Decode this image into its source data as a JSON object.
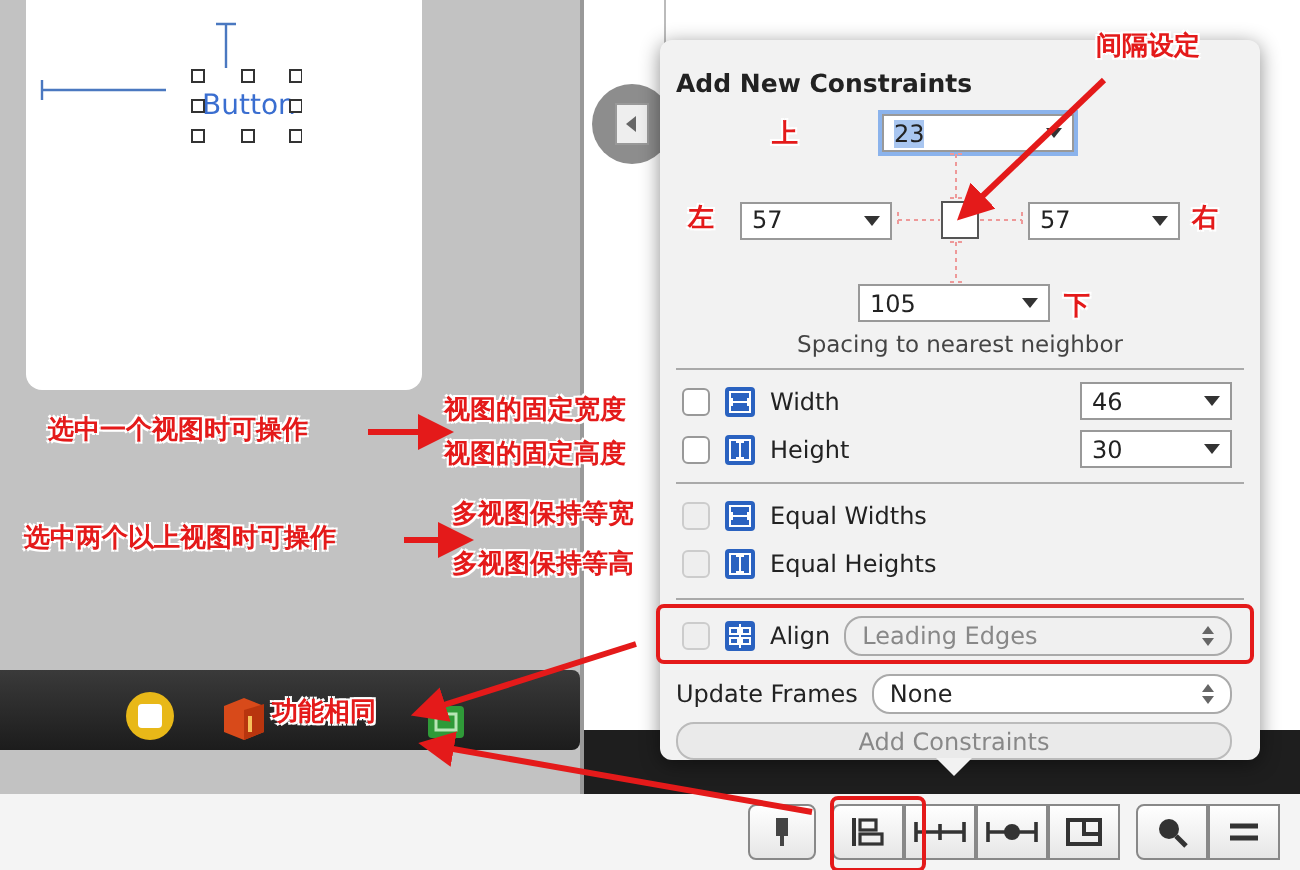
{
  "canvas": {
    "button_label": "Button"
  },
  "popover": {
    "title": "Add New Constraints",
    "spacing": [
      {
        "kind": "top",
        "value": "23",
        "focused": true
      },
      {
        "kind": "left",
        "value": "57",
        "focused": false
      },
      {
        "kind": "right",
        "value": "57",
        "focused": false
      },
      {
        "kind": "bottom",
        "value": "105",
        "focused": false
      }
    ],
    "spacing_caption": "Spacing to nearest neighbor",
    "constraints": [
      {
        "kind": "width",
        "label": "Width",
        "value": "46",
        "checked": false,
        "disabled": false
      },
      {
        "kind": "height",
        "label": "Height",
        "value": "30",
        "checked": false,
        "disabled": false
      },
      {
        "kind": "width",
        "label": "Equal Widths",
        "checked": false,
        "disabled": true
      },
      {
        "kind": "height",
        "label": "Equal Heights",
        "checked": false,
        "disabled": true
      }
    ],
    "align": {
      "label": "Align",
      "value": "Leading Edges",
      "checked": false,
      "disabled": true
    },
    "update_frames": {
      "label": "Update Frames",
      "value": "None"
    },
    "add_button": {
      "label": "Add Constraints",
      "disabled": true
    }
  },
  "annotations": [
    {
      "text": "间隔设定"
    },
    {
      "text": "上"
    },
    {
      "text": "左"
    },
    {
      "text": "右"
    },
    {
      "text": "下"
    },
    {
      "text": "视图的固定宽度"
    },
    {
      "text": "视图的固定高度"
    },
    {
      "text": "多视图保持等宽"
    },
    {
      "text": "多视图保持等高"
    },
    {
      "text": "选中一个视图时可操作"
    },
    {
      "text": "选中两个以上视图时可操作"
    },
    {
      "text": "功能相同"
    }
  ]
}
